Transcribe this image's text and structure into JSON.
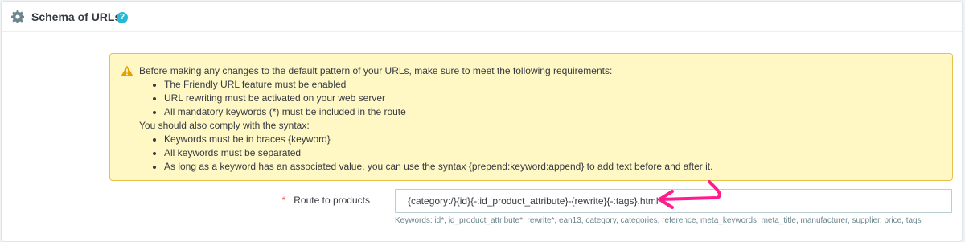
{
  "panel": {
    "title": "Schema of URLs",
    "help_icon_glyph": "?",
    "icons": [
      "gear-icon",
      "help-icon"
    ]
  },
  "alert": {
    "intro": "Before making any changes to the default pattern of your URLs, make sure to meet the following requirements:",
    "requirements": [
      "The Friendly URL feature must be enabled",
      "URL rewriting must be activated on your web server",
      "All mandatory keywords (*) must be included in the route"
    ],
    "syntax_intro": "You should also comply with the syntax:",
    "syntax_rules": [
      "Keywords must be in braces {keyword}",
      "All keywords must be separated",
      "As long as a keyword has an associated value, you can use the syntax {prepend:keyword:append} to add text before and after it."
    ],
    "icon": "warning-icon"
  },
  "form": {
    "required_mark": "*",
    "route_label": "Route to products",
    "route_value": "{category:/}{id}{-:id_product_attribute}-{rewrite}{-:tags}.html",
    "keywords_help": "Keywords: id*, id_product_attribute*, rewrite*, ean13, category, categories, reference, meta_keywords, meta_title, manufacturer, supplier, price, tags"
  },
  "annotation": {
    "icon": "pink-arrow-icon",
    "color": "#ff1d8e"
  },
  "colors": {
    "accent": "#25b9d7",
    "warning_bg": "#fff8c5",
    "warning_border": "#e6c24d",
    "required": "#f54c3e"
  }
}
